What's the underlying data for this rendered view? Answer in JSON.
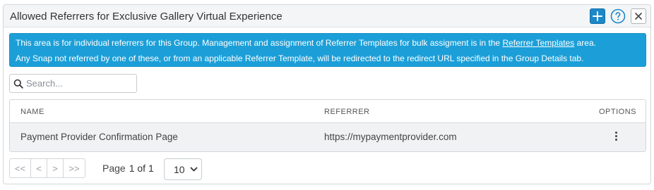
{
  "panel": {
    "title": "Allowed Referrers for Exclusive Gallery Virtual Experience",
    "add_icon": "plus-icon",
    "help_icon": "question-circle-icon",
    "close_icon": "close-icon",
    "accent_color": "#1c88c8"
  },
  "info": {
    "line1_prefix": "This area is for individual referrers for this Group. Management and assignment of Referrer Templates for bulk assigment is in the",
    "line1_link": "Referrer Templates",
    "line1_suffix": "area.",
    "line2": "Any Snap not referred by one of these, or from an applicable Referrer Template, will be redirected to the redirect URL specified in the Group Details tab.",
    "background_color": "#1c9fd8"
  },
  "search": {
    "placeholder": "Search...",
    "value": "",
    "icon": "search-icon"
  },
  "table": {
    "columns": [
      "NAME",
      "REFERRER",
      "OPTIONS"
    ],
    "rows": [
      {
        "name": "Payment Provider Confirmation Page",
        "referrer": "https://mypaymentprovider.com",
        "options_icon": "more-vertical-icon"
      }
    ]
  },
  "pagination": {
    "first": "<<",
    "prev": "<",
    "next": ">",
    "last": ">>",
    "page_label": "Page",
    "page_text": "1 of 1",
    "page_size": "10"
  }
}
